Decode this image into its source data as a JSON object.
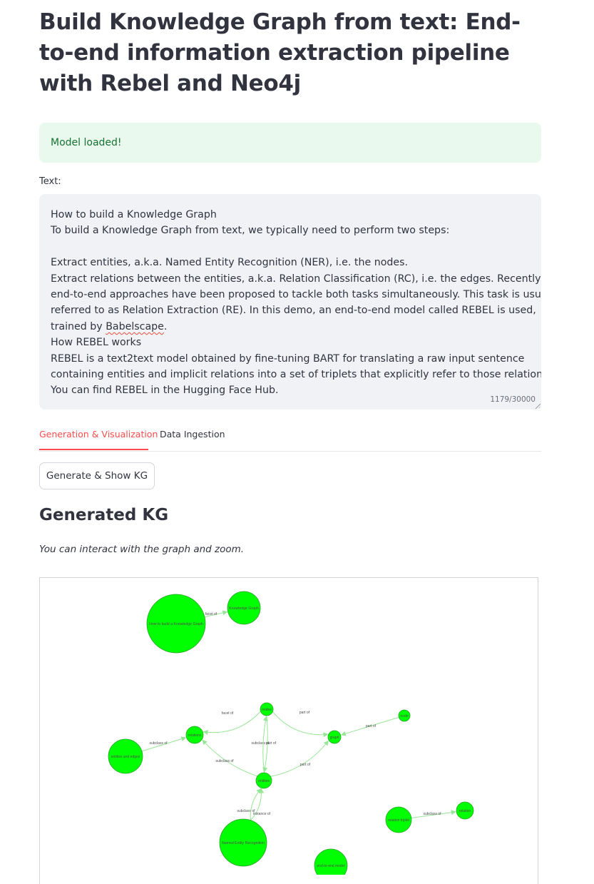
{
  "page": {
    "title": "Build Knowledge Graph from text: End-to-end information extraction pipeline with Rebel and Neo4j",
    "alert": "Model loaded!",
    "text_label": "Text:",
    "text_lines": [
      "How to build a Knowledge Graph",
      "To build a Knowledge Graph from text, we typically need to perform two steps:",
      "",
      "Extract entities, a.k.a. Named Entity Recognition (NER), i.e. the nodes.",
      "Extract relations between the entities, a.k.a. Relation Classification (RC), i.e. the edges. Recently,",
      "end-to-end approaches have been proposed to tackle both tasks simultaneously. This task is usually",
      "referred to as Relation Extraction (RE). In this demo, an end-to-end model called REBEL is used,",
      "trained by ",
      "How REBEL works",
      "REBEL is a text2text model obtained by fine-tuning BART for translating a raw input sentence",
      "containing entities and implicit relations into a set of triplets that explicitly refer to those relations.",
      "You can find REBEL in the Hugging Face Hub."
    ],
    "text_flagged_word": "Babelscape",
    "text_flagged_suffix": ".",
    "char_count": "1179/30000",
    "tabs": [
      "Generation & Visualization",
      "Data Ingestion"
    ],
    "button_label": "Generate & Show KG",
    "section_heading": "Generated KG",
    "caption": "You can interact with the graph and zoom."
  },
  "graph": {
    "node_color": "#00ff00",
    "node_border": "#2b9e2b",
    "edge_color": "#97e697",
    "nodes": [
      {
        "id": "how_to",
        "label": "How to build a Knowledge Graph"
      },
      {
        "id": "kg",
        "label": "Knowledge Graph"
      },
      {
        "id": "nodes",
        "label": "nodes"
      },
      {
        "id": "relations",
        "label": "relations"
      },
      {
        "id": "graph",
        "label": "graph"
      },
      {
        "id": "node",
        "label": "node"
      },
      {
        "id": "entities_edges",
        "label": "entities and edges"
      },
      {
        "id": "entities",
        "label": "entities"
      },
      {
        "id": "ner",
        "label": "Named Entity Recognition"
      },
      {
        "id": "relation_triplet",
        "label": "relation triplet"
      },
      {
        "id": "relation",
        "label": "relation"
      },
      {
        "id": "e2e",
        "label": "end-to-end model"
      }
    ],
    "edges": [
      {
        "from": "how_to",
        "to": "kg",
        "label": "facet of"
      },
      {
        "from": "nodes",
        "to": "relations",
        "label": "facet of"
      },
      {
        "from": "nodes",
        "to": "graph",
        "label": "part of"
      },
      {
        "from": "node",
        "to": "graph",
        "label": "part of"
      },
      {
        "from": "entities_edges",
        "to": "relations",
        "label": "subclass of"
      },
      {
        "from": "nodes",
        "to": "entities",
        "label": "subclass of"
      },
      {
        "from": "entities",
        "to": "nodes",
        "label": "part of"
      },
      {
        "from": "entities",
        "to": "relations",
        "label": "subclass of"
      },
      {
        "from": "entities",
        "to": "graph",
        "label": "part of"
      },
      {
        "from": "ner",
        "to": "entities",
        "label": "subclass of"
      },
      {
        "from": "ner",
        "to": "entities",
        "label": "instance of"
      },
      {
        "from": "relation_triplet",
        "to": "relation",
        "label": "subclass of"
      }
    ]
  }
}
